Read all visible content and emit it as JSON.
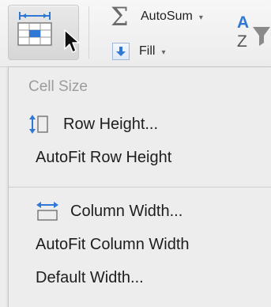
{
  "ribbon": {
    "format_button": {
      "icon": "format-cells-icon",
      "caret": "chevron-down-icon"
    },
    "autosum": {
      "icon": "sigma-icon",
      "label": "AutoSum",
      "caret": "▾"
    },
    "fill": {
      "icon": "fill-down-icon",
      "label": "Fill",
      "caret": "▾"
    },
    "sort": {
      "icon": "sort-az-icon"
    }
  },
  "menu": {
    "header": "Cell Size",
    "row_items": [
      {
        "icon": "row-height-icon",
        "label": "Row Height..."
      },
      {
        "label": "AutoFit Row Height"
      }
    ],
    "column_items": [
      {
        "icon": "column-width-icon",
        "label": "Column Width..."
      },
      {
        "label": "AutoFit Column Width"
      },
      {
        "label": "Default Width..."
      }
    ]
  },
  "colors": {
    "accent_blue": "#2f78d6",
    "menu_text": "#1d1d1d",
    "header_text": "#9c9c9c"
  }
}
